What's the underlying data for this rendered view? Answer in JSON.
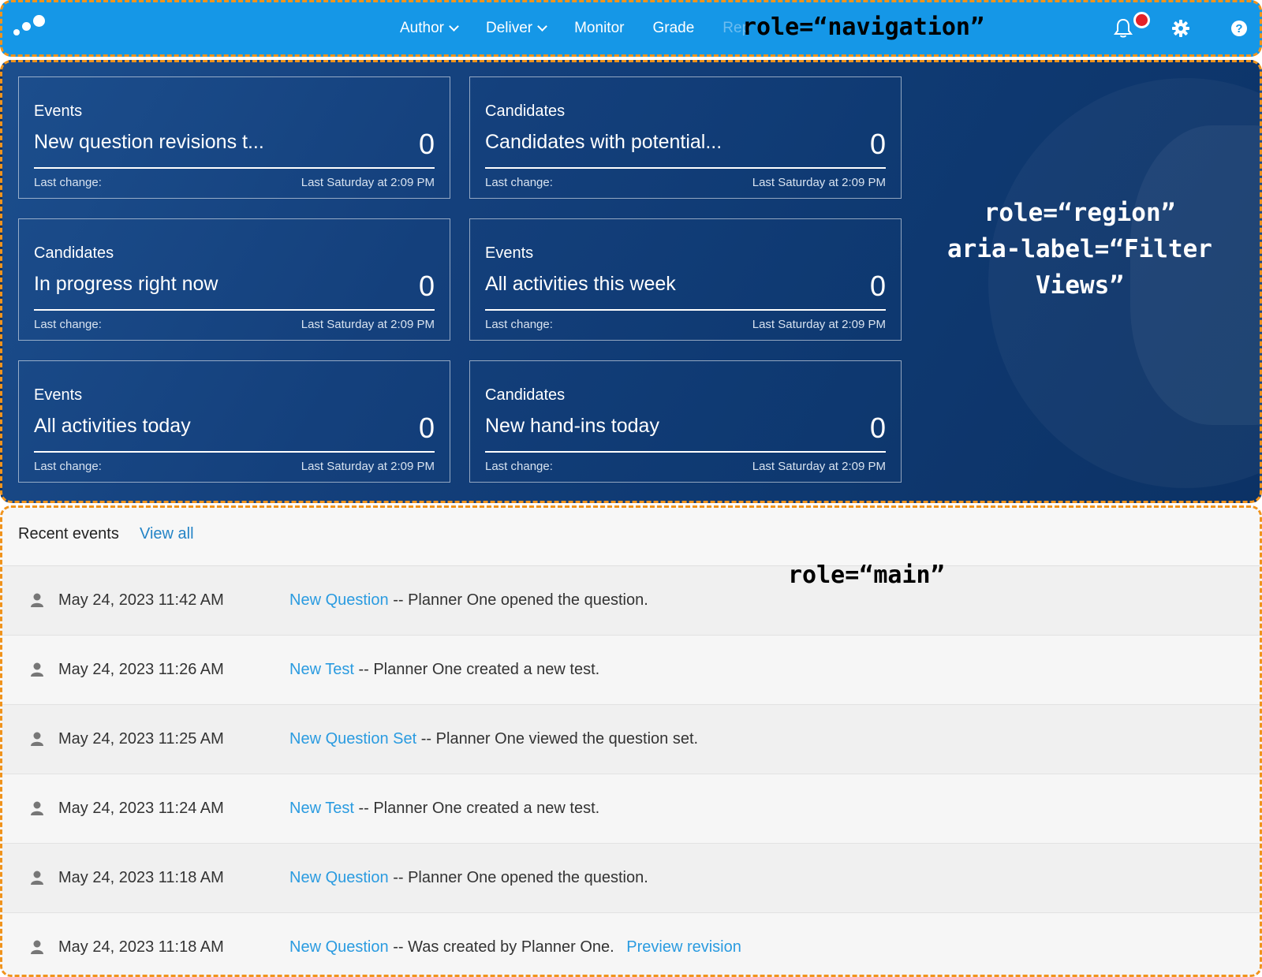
{
  "nav": {
    "menu": [
      {
        "label": "Author",
        "has_dropdown": true
      },
      {
        "label": "Deliver",
        "has_dropdown": true
      },
      {
        "label": "Monitor",
        "has_dropdown": false
      },
      {
        "label": "Grade",
        "has_dropdown": false
      },
      {
        "label": "Rep",
        "has_dropdown": false,
        "truncated": true
      }
    ],
    "icons": [
      "logo-icon",
      "bell-icon",
      "gear-icon",
      "help-icon"
    ],
    "annotation": "role=“navigation”",
    "colors": {
      "bar": "#1597e7",
      "notification_dot": "#e32128",
      "annotation_outline": "#f0931c"
    }
  },
  "region": {
    "annotation_line1": "role=“region”",
    "annotation_line2": "aria-label=“Filter Views”",
    "cards": [
      {
        "category": "Events",
        "title": "New question revisions t...",
        "count": "0",
        "last_change_label": "Last change:",
        "last_change_value": "Last Saturday at 2:09 PM"
      },
      {
        "category": "Candidates",
        "title": "Candidates with potential...",
        "count": "0",
        "last_change_label": "Last change:",
        "last_change_value": "Last Saturday at 2:09 PM"
      },
      {
        "category": "Candidates",
        "title": "In progress right now",
        "count": "0",
        "last_change_label": "Last change:",
        "last_change_value": "Last Saturday at 2:09 PM"
      },
      {
        "category": "Events",
        "title": "All activities this week",
        "count": "0",
        "last_change_label": "Last change:",
        "last_change_value": "Last Saturday at 2:09 PM"
      },
      {
        "category": "Events",
        "title": "All activities today",
        "count": "0",
        "last_change_label": "Last change:",
        "last_change_value": "Last Saturday at 2:09 PM"
      },
      {
        "category": "Candidates",
        "title": "New hand-ins today",
        "count": "0",
        "last_change_label": "Last change:",
        "last_change_value": "Last Saturday at 2:09 PM"
      }
    ],
    "colors": {
      "background": "#14407c",
      "text": "#ffffff"
    }
  },
  "main": {
    "heading": "Recent events",
    "view_all": "View all",
    "annotation": "role=“main”",
    "events": [
      {
        "date": "May 24, 2023 11:42 AM",
        "link": "New Question",
        "separator": "--",
        "text": "Planner One opened the question.",
        "extra_link": ""
      },
      {
        "date": "May 24, 2023 11:26 AM",
        "link": "New Test",
        "separator": "--",
        "text": "Planner One created a new test.",
        "extra_link": ""
      },
      {
        "date": "May 24, 2023 11:25 AM",
        "link": "New Question Set",
        "separator": "--",
        "text": "Planner One viewed the question set.",
        "extra_link": ""
      },
      {
        "date": "May 24, 2023 11:24 AM",
        "link": "New Test",
        "separator": "--",
        "text": "Planner One created a new test.",
        "extra_link": ""
      },
      {
        "date": "May 24, 2023 11:18 AM",
        "link": "New Question",
        "separator": "--",
        "text": "Planner One opened the question.",
        "extra_link": ""
      },
      {
        "date": "May 24, 2023 11:18 AM",
        "link": "New Question",
        "separator": "--",
        "text": "Was created by Planner One.",
        "extra_link": "Preview revision"
      }
    ],
    "colors": {
      "link": "#2a9be0",
      "view_all": "#2484c6"
    }
  }
}
